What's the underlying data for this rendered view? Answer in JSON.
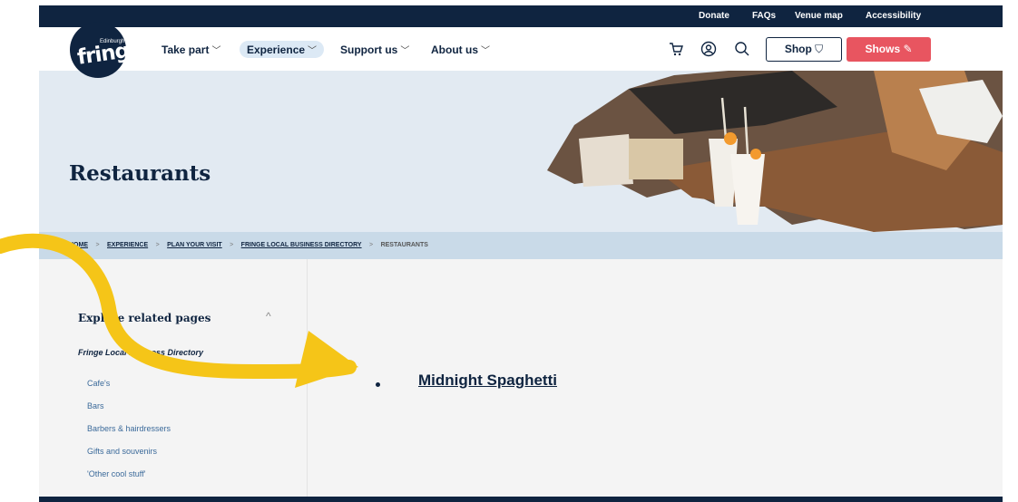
{
  "utility_bar": {
    "links": [
      "Donate",
      "FAQs",
      "Venue map",
      "Accessibility"
    ]
  },
  "logo": {
    "small": "Edinburgh",
    "big": "fringe"
  },
  "nav": {
    "items": [
      {
        "label": "Take part",
        "chevron": "﹀"
      },
      {
        "label": "Experience",
        "chevron": "﹀"
      },
      {
        "label": "Support us",
        "chevron": "﹀"
      },
      {
        "label": "About us",
        "chevron": "﹀"
      }
    ],
    "shop_label": "Shop",
    "shows_label": "Shows",
    "icons": [
      "cart-icon",
      "account-icon",
      "search-icon"
    ]
  },
  "hero": {
    "title": "Restaurants"
  },
  "breadcrumb": {
    "items": [
      "HOME",
      "EXPERIENCE",
      "PLAN YOUR VISIT",
      "FRINGE LOCAL BUSINESS DIRECTORY",
      "RESTAURANTS"
    ],
    "separator": ">"
  },
  "sidebar": {
    "title": "Explore related pages",
    "chevron": "^",
    "subtitle": "Fringe Local Business Directory",
    "links": [
      "Cafe's",
      "Bars",
      "Barbers & hairdressers",
      "Gifts and souvenirs",
      "'Other cool stuff'"
    ]
  },
  "main": {
    "links": [
      "Midnight Spaghetti"
    ]
  },
  "colors": {
    "navy": "#0f2440",
    "shows_red": "#e85560",
    "hero_bg": "#e2eaf2",
    "crumb_bg": "#c9dae8",
    "arrow_yellow": "#f5c518"
  }
}
